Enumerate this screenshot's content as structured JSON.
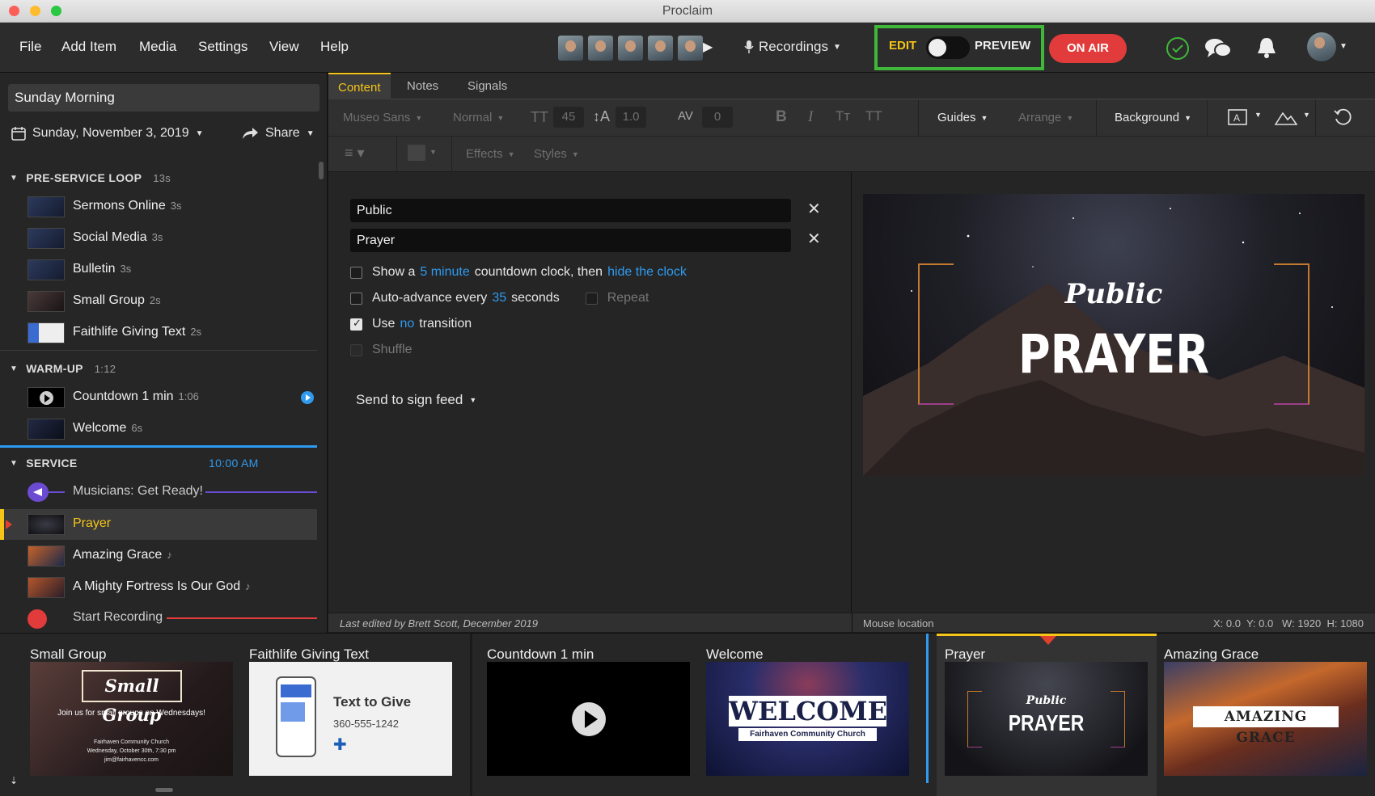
{
  "window": {
    "title": "Proclaim"
  },
  "menu": [
    "File",
    "Add Item",
    "Media",
    "Settings",
    "View",
    "Help"
  ],
  "toolbar": {
    "recordings_label": "Recordings",
    "edit_label": "EDIT",
    "preview_label": "PREVIEW",
    "on_air_label": "ON AIR",
    "edit_mode_on": false
  },
  "sidebar": {
    "presentation_title": "Sunday Morning",
    "date": "Sunday, November 3, 2019",
    "share_label": "Share",
    "sections": [
      {
        "title": "PRE-SERVICE LOOP",
        "meta": "13s",
        "items": [
          {
            "name": "Sermons Online",
            "duration": "3s"
          },
          {
            "name": "Social Media",
            "duration": "3s"
          },
          {
            "name": "Bulletin",
            "duration": "3s"
          },
          {
            "name": "Small Group",
            "duration": "2s"
          },
          {
            "name": "Faithlife Giving Text",
            "duration": "2s"
          }
        ]
      },
      {
        "title": "WARM-UP",
        "meta": "1:12",
        "items": [
          {
            "name": "Countdown 1 min",
            "duration": "1:06"
          },
          {
            "name": "Welcome",
            "duration": "6s"
          }
        ]
      },
      {
        "title": "SERVICE",
        "meta": "10:00 AM",
        "items": [
          {
            "name": "Musicians: Get Ready!",
            "duration": ""
          },
          {
            "name": "Prayer",
            "duration": ""
          },
          {
            "name": "Amazing Grace",
            "duration": ""
          },
          {
            "name": "A Mighty Fortress Is Our God",
            "duration": ""
          },
          {
            "name": "Start Recording",
            "duration": ""
          }
        ]
      }
    ]
  },
  "editor": {
    "tabs": [
      "Content",
      "Notes",
      "Signals"
    ],
    "format": {
      "font": "Museo Sans",
      "weight": "Normal",
      "size": "45",
      "line_height": "1.0",
      "tracking": "0",
      "guides": "Guides",
      "arrange": "Arrange",
      "background": "Background",
      "effects": "Effects",
      "styles": "Styles"
    },
    "fields": [
      "Public",
      "Prayer"
    ],
    "options": {
      "show_a": "Show a",
      "countdown_link": "5 minute",
      "countdown_mid": "countdown clock, then",
      "hide_link": "hide the clock",
      "auto_advance": "Auto-advance every",
      "seconds_value": "35",
      "seconds_label": "seconds",
      "repeat": "Repeat",
      "use": "Use",
      "transition_link": "no",
      "transition_label": "transition",
      "shuffle": "Shuffle",
      "transition_checked": true
    },
    "send_label": "Send to sign feed",
    "preview": {
      "script_text": "Public",
      "main_text": "PRAYER"
    },
    "status_left": "Last edited by Brett Scott, December 2019",
    "mouse_label": "Mouse location",
    "coords": "X: 0.0  Y: 0.0   W: 1920  H: 1080"
  },
  "strip": [
    {
      "label": "Small Group",
      "script": "Small Group",
      "line1": "Join us for small groups on Wednesdays!",
      "line2": "Fairhaven Community Church",
      "line3": "Wednesday, October 30th, 7:30 pm",
      "line4": "jim@fairhavencc.com"
    },
    {
      "label": "Faithlife Giving Text",
      "title": "Text to Give",
      "phone": "360-555-1242"
    },
    {
      "label": "Countdown 1 min"
    },
    {
      "label": "Welcome",
      "big": "WELCOME",
      "sub": "Fairhaven Community Church"
    },
    {
      "label": "Prayer",
      "script": "Public",
      "big": "PRAYER"
    },
    {
      "label": "Amazing Grace",
      "big": "AMAZING GRACE"
    }
  ],
  "colors": {
    "accent": "#f5c518",
    "link": "#2f9bf0",
    "on_air": "#e23b3b",
    "edit_border": "#3fb83a"
  }
}
